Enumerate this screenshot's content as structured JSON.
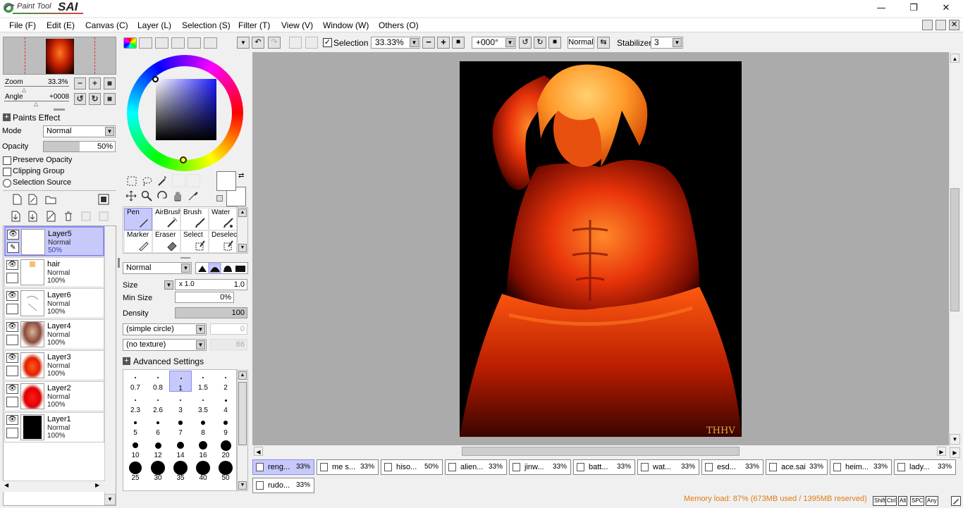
{
  "app": {
    "name_small": "Paint Tool",
    "name_big": "SAI"
  },
  "window_controls": {
    "minimize": "—",
    "maximize": "❐",
    "close": "✕"
  },
  "menu": [
    "File (F)",
    "Edit (E)",
    "Canvas (C)",
    "Layer (L)",
    "Selection (S)",
    "Filter (T)",
    "View (V)",
    "Window (W)",
    "Others (O)"
  ],
  "navigator": {
    "zoom_label": "Zoom",
    "zoom_value": "33.3%",
    "angle_label": "Angle",
    "angle_value": "+0008"
  },
  "paints_effect": {
    "header": "Paints Effect",
    "mode_label": "Mode",
    "mode_value": "Normal",
    "opacity_label": "Opacity",
    "opacity_value": "50%",
    "opacity_fraction": 0.5,
    "preserve_opacity": "Preserve Opacity",
    "clipping_group": "Clipping Group",
    "selection_source": "Selection Source"
  },
  "layers": [
    {
      "name": "Layer5",
      "mode": "Normal",
      "opacity": "50%",
      "selected": true
    },
    {
      "name": "hair",
      "mode": "Normal",
      "opacity": "100%"
    },
    {
      "name": "Layer6",
      "mode": "Normal",
      "opacity": "100%"
    },
    {
      "name": "Layer4",
      "mode": "Normal",
      "opacity": "100%"
    },
    {
      "name": "Layer3",
      "mode": "Normal",
      "opacity": "100%"
    },
    {
      "name": "Layer2",
      "mode": "Normal",
      "opacity": "100%"
    },
    {
      "name": "Layer1",
      "mode": "Normal",
      "opacity": "100%"
    }
  ],
  "tools": [
    {
      "label": "Pen",
      "selected": true
    },
    {
      "label": "AirBrush"
    },
    {
      "label": "Brush"
    },
    {
      "label": "Water"
    },
    {
      "label": "Marker"
    },
    {
      "label": "Eraser"
    },
    {
      "label": "Select"
    },
    {
      "label": "Deselect"
    }
  ],
  "brush": {
    "blend_mode": "Normal",
    "size_label": "Size",
    "size_mult": "x 1.0",
    "size_value": "1.0",
    "min_size_label": "Min Size",
    "min_size_value": "0%",
    "density_label": "Density",
    "density_value": "100",
    "shape": "(simple circle)",
    "shape_value": "0",
    "texture": "(no texture)",
    "texture_value": "66",
    "advanced": "Advanced Settings",
    "sizes": [
      "0.7",
      "0.8",
      "1",
      "1.5",
      "2",
      "2.3",
      "2.6",
      "3",
      "3.5",
      "4",
      "5",
      "6",
      "7",
      "8",
      "9",
      "10",
      "12",
      "14",
      "16",
      "20",
      "25",
      "30",
      "35",
      "40",
      "50"
    ]
  },
  "toolbar": {
    "selection_label": "Selection",
    "zoom": "33.33%",
    "angle": "+000°",
    "blend": "Normal",
    "stabilizer_label": "Stabilizer",
    "stabilizer_value": "3"
  },
  "canvas": {
    "signature": "THHV"
  },
  "docs": [
    {
      "name": "reng...",
      "pct": "33%",
      "selected": true
    },
    {
      "name": "me s...",
      "pct": "33%"
    },
    {
      "name": "hiso...",
      "pct": "50%"
    },
    {
      "name": "alien...",
      "pct": "33%"
    },
    {
      "name": "jinw...",
      "pct": "33%"
    },
    {
      "name": "batt...",
      "pct": "33%"
    },
    {
      "name": "wat...",
      "pct": "33%"
    },
    {
      "name": "esd...",
      "pct": "33%"
    },
    {
      "name": "ace.sai",
      "pct": "33%"
    },
    {
      "name": "heim...",
      "pct": "33%"
    },
    {
      "name": "lady...",
      "pct": "33%"
    },
    {
      "name": "rudo...",
      "pct": "33%"
    }
  ],
  "status": {
    "memory": "Memory load: 87% (673MB used / 1395MB reserved)"
  },
  "modifiers": [
    "Shift",
    "Ctrl",
    "Alt",
    "SPC",
    "Any"
  ]
}
